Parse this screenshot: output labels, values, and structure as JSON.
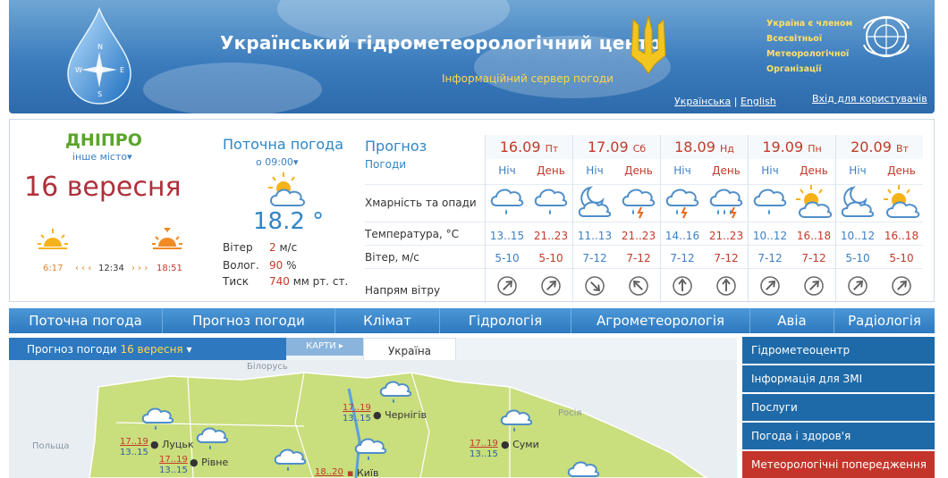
{
  "header": {
    "title": "Український гідрометеорологічний центр",
    "subtitle": "Інформаційний сервер погоди",
    "wmo_lines": [
      "Україна є членом",
      "Всесвітньої",
      "Метеорологічної",
      "Організації"
    ],
    "lang_ua": "Українська",
    "lang_sep": "|",
    "lang_en": "English",
    "login": "Вхід для користувачів"
  },
  "location": {
    "city": "ДНІПРО",
    "other_city": "інше місто",
    "date": "16 вересня",
    "sunrise": "6:17",
    "noon": "12:34",
    "sunset": "18:51",
    "arrows_left": "‹ ‹ ‹",
    "arrows_right": "› › ›"
  },
  "current": {
    "title": "Поточна погода",
    "time": "о 09:00",
    "temp": "18.2 °",
    "wind_label": "Вітер",
    "wind_value": "2",
    "wind_unit": "м/с",
    "humidity_label": "Волог.",
    "humidity_value": "90",
    "humidity_unit": "%",
    "pressure_label": "Тиск",
    "pressure_value": "740",
    "pressure_unit": "мм рт. ст."
  },
  "forecast": {
    "title": "Прогноз",
    "subtitle": "Погоди",
    "row_clouds": "Хмарність та опади",
    "row_temp": "Температура, °С",
    "row_wind": "Вітер, м/с",
    "row_dir": "Напрям вітру",
    "night_label": "Ніч",
    "day_label": "День",
    "days": [
      {
        "date": "16.09",
        "dow": "Пт",
        "night_icon": "cloud-rain-icon",
        "day_icon": "cloud-rain-icon",
        "night_temp": "13..15",
        "day_temp": "21..23",
        "night_wind": "5-10",
        "day_wind": "5-10",
        "night_dir": "north-east",
        "day_dir": "north-east"
      },
      {
        "date": "17.09",
        "dow": "Сб",
        "night_icon": "moon-cloud-icon",
        "day_icon": "cloud-thunder-icon",
        "night_temp": "11..13",
        "day_temp": "21..23",
        "night_wind": "7-12",
        "day_wind": "7-12",
        "night_dir": "south-east",
        "day_dir": "north-west"
      },
      {
        "date": "18.09",
        "dow": "Нд",
        "night_icon": "cloud-thunder-icon",
        "day_icon": "cloud-heavy-rain-icon",
        "night_temp": "14..16",
        "day_temp": "21..23",
        "night_wind": "7-12",
        "day_wind": "7-12",
        "night_dir": "north",
        "day_dir": "north"
      },
      {
        "date": "19.09",
        "dow": "Пн",
        "night_icon": "cloud-rain-icon",
        "day_icon": "sun-cloud-icon",
        "night_temp": "10..12",
        "day_temp": "16..18",
        "night_wind": "7-12",
        "day_wind": "7-12",
        "night_dir": "north-east",
        "day_dir": "north-east"
      },
      {
        "date": "20.09",
        "dow": "Вт",
        "night_icon": "moon-cloud-icon",
        "day_icon": "sun-cloud-icon",
        "night_temp": "10..12",
        "day_temp": "16..18",
        "night_wind": "5-10",
        "day_wind": "5-10",
        "night_dir": "north-east",
        "day_dir": "north-east"
      }
    ]
  },
  "nav": [
    "Поточна погода",
    "Прогноз погоди",
    "Клімат",
    "Гідрологія",
    "Агрометеорологія",
    "Авіа",
    "Радіологія"
  ],
  "map": {
    "tab_prefix": "Прогноз погоди",
    "tab_date": "16 вересня",
    "tab_maps": "КАРТИ",
    "tab_region": "Україна",
    "countries": {
      "belarus": "Білорусь",
      "poland": "Польща",
      "russia": "Росія"
    },
    "cities": [
      {
        "name": "Луцьк",
        "day": "17..19",
        "night": "13..15"
      },
      {
        "name": "Рівне",
        "day": "17..19",
        "night": "13..15"
      },
      {
        "name": "Чернігів",
        "day": "17..19",
        "night": "13..15"
      },
      {
        "name": "Суми",
        "day": "17..19",
        "night": "13..15"
      },
      {
        "name": "Київ",
        "day": "18..20",
        "night": ""
      }
    ]
  },
  "sidebar": [
    "Гідрометеоцентр",
    "Інформація для ЗМІ",
    "Послуги",
    "Погода і здоров'я",
    "Метеорологічні попередження"
  ],
  "colors": {
    "primary": "#2d78bf",
    "accent_red": "#c23a2a",
    "accent_green": "#5aa52a",
    "warning": "#c3352b"
  }
}
